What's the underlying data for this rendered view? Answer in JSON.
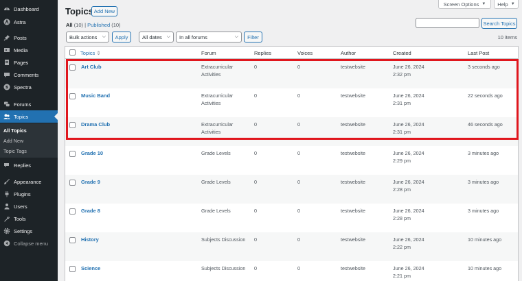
{
  "sidebar": {
    "items": [
      {
        "label": "Dashboard",
        "icon": "dashboard-icon"
      },
      {
        "label": "Astra",
        "icon": "astra-icon"
      },
      {
        "label": "Posts",
        "icon": "pin-icon"
      },
      {
        "label": "Media",
        "icon": "media-icon"
      },
      {
        "label": "Pages",
        "icon": "page-icon"
      },
      {
        "label": "Comments",
        "icon": "comment-icon"
      },
      {
        "label": "Spectra",
        "icon": "spectra-icon"
      },
      {
        "label": "Forums",
        "icon": "forums-icon"
      },
      {
        "label": "Topics",
        "icon": "topics-icon"
      },
      {
        "label": "Replies",
        "icon": "replies-icon"
      },
      {
        "label": "Appearance",
        "icon": "brush-icon"
      },
      {
        "label": "Plugins",
        "icon": "plugin-icon"
      },
      {
        "label": "Users",
        "icon": "users-icon"
      },
      {
        "label": "Tools",
        "icon": "wrench-icon"
      },
      {
        "label": "Settings",
        "icon": "settings-icon"
      },
      {
        "label": "Collapse menu",
        "icon": "collapse-icon"
      }
    ],
    "submenu": [
      "All Topics",
      "Add New",
      "Topic Tags"
    ],
    "accent": "#2271b1"
  },
  "header": {
    "title": "Topics",
    "add_new": "Add New",
    "screen_options": "Screen Options",
    "help": "Help"
  },
  "views": {
    "all": "All",
    "all_count": "(10)",
    "sep": "|",
    "published": "Published",
    "published_count": "(10)"
  },
  "search": {
    "button": "Search Topics",
    "value": ""
  },
  "filters": {
    "bulk_actions": "Bulk actions",
    "apply": "Apply",
    "dates": "All dates",
    "forums": "In all forums",
    "filter": "Filter",
    "items_count": "10 items"
  },
  "table": {
    "columns": [
      "Topics",
      "Forum",
      "Replies",
      "Voices",
      "Author",
      "Created",
      "Last Post"
    ],
    "rows": [
      {
        "title": "Art Club",
        "forum": [
          "Extracurricular",
          "Activities"
        ],
        "replies": "0",
        "voices": "0",
        "author": "testwebsite",
        "created": [
          "June 26, 2024",
          "2:32 pm"
        ],
        "last_post": "3 seconds ago"
      },
      {
        "title": "Music Band",
        "forum": [
          "Extracurricular",
          "Activities"
        ],
        "replies": "0",
        "voices": "0",
        "author": "testwebsite",
        "created": [
          "June 26, 2024",
          "2:31 pm"
        ],
        "last_post": "22 seconds ago"
      },
      {
        "title": "Drama Club",
        "forum": [
          "Extracurricular",
          "Activities"
        ],
        "replies": "0",
        "voices": "0",
        "author": "testwebsite",
        "created": [
          "June 26, 2024",
          "2:31 pm"
        ],
        "last_post": "46 seconds ago"
      },
      {
        "title": "Grade 10",
        "forum": [
          "Grade Levels",
          ""
        ],
        "replies": "0",
        "voices": "0",
        "author": "testwebsite",
        "created": [
          "June 26, 2024",
          "2:29 pm"
        ],
        "last_post": "3 minutes ago"
      },
      {
        "title": "Grade 9",
        "forum": [
          "Grade Levels",
          ""
        ],
        "replies": "0",
        "voices": "0",
        "author": "testwebsite",
        "created": [
          "June 26, 2024",
          "2:28 pm"
        ],
        "last_post": "3 minutes ago"
      },
      {
        "title": "Grade 8",
        "forum": [
          "Grade Levels",
          ""
        ],
        "replies": "0",
        "voices": "0",
        "author": "testwebsite",
        "created": [
          "June 26, 2024",
          "2:28 pm"
        ],
        "last_post": "3 minutes ago"
      },
      {
        "title": "History",
        "forum": [
          "Subjects Discussion",
          ""
        ],
        "replies": "0",
        "voices": "0",
        "author": "testwebsite",
        "created": [
          "June 26, 2024",
          "2:22 pm"
        ],
        "last_post": "10 minutes ago"
      },
      {
        "title": "Science",
        "forum": [
          "Subjects Discussion",
          ""
        ],
        "replies": "0",
        "voices": "0",
        "author": "testwebsite",
        "created": [
          "June 26, 2024",
          "2:21 pm"
        ],
        "last_post": "10 minutes ago"
      }
    ]
  },
  "highlight_color": "#e0161d"
}
